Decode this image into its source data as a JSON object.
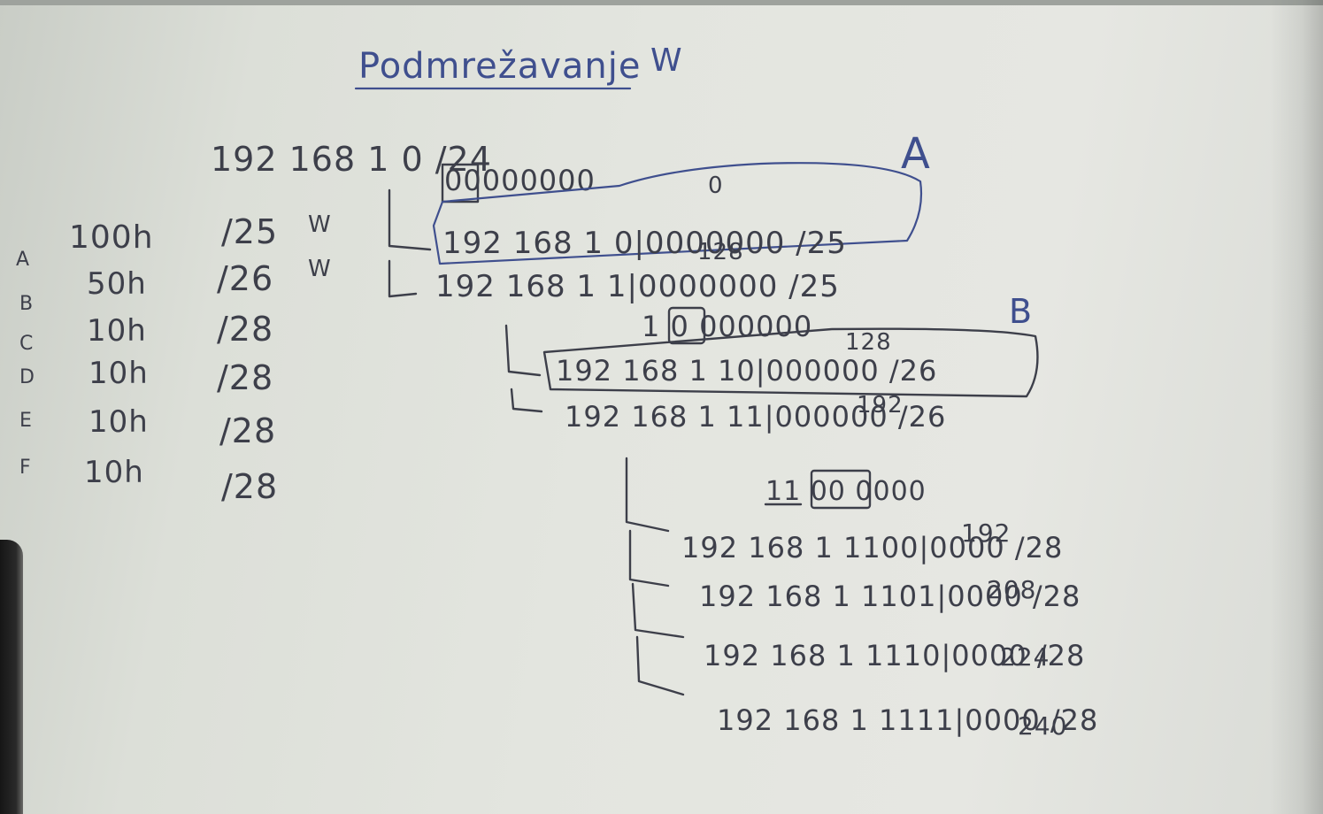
{
  "title": "Podmrežavanje",
  "title_mark": "W",
  "network": "192 168 1 0 /24",
  "requirements": [
    {
      "label": "A",
      "hosts": "100h",
      "prefix": "/25",
      "mark": "W"
    },
    {
      "label": "B",
      "hosts": "50h",
      "prefix": "/26",
      "mark": "W"
    },
    {
      "label": "C",
      "hosts": "10h",
      "prefix": "/28",
      "mark": ""
    },
    {
      "label": "D",
      "hosts": "10h",
      "prefix": "/28",
      "mark": ""
    },
    {
      "label": "E",
      "hosts": "10h",
      "prefix": "/28",
      "mark": ""
    },
    {
      "label": "F",
      "hosts": "10h",
      "prefix": "/28",
      "mark": ""
    }
  ],
  "tree": {
    "level1": {
      "pivot_bits": "00000000",
      "pivot_value": "0",
      "subnet_label": "A",
      "left": "192 168 1 0|0000000 /25",
      "right_value": "128",
      "right": "192 168 1 1|0000000 /25"
    },
    "level2": {
      "pivot_bits": "1 0 000000",
      "pivot_value": "128",
      "subnet_label": "B",
      "left": "192 168 1 10|000000 /26",
      "right_value": "192",
      "right": "192 168 1 11|000000 /26"
    },
    "level3": {
      "pivot_bits": "11 00 0000",
      "rows": [
        {
          "value": "192",
          "text": "192 168 1 1100|0000 /28"
        },
        {
          "value": "208",
          "text": "192 168 1 1101|0000 /28"
        },
        {
          "value": "224",
          "text": "192 168 1 1110|0000 /28"
        },
        {
          "value": "240",
          "text": "192 168 1 1111|0000 /28"
        }
      ]
    }
  }
}
